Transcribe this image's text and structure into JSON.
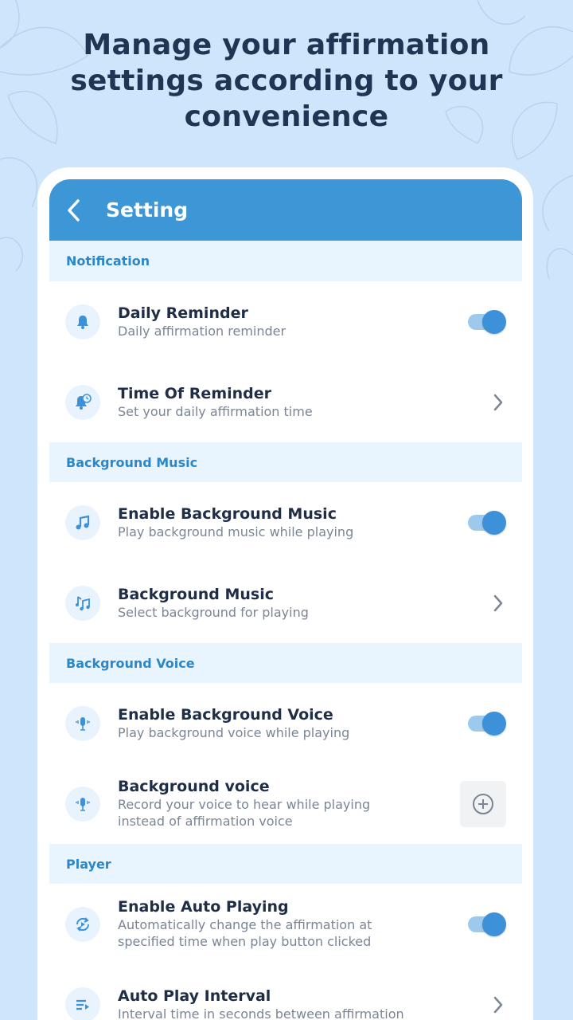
{
  "headline": "Manage your affirmation settings according to your convenience",
  "appbar": {
    "title": "Setting"
  },
  "colors": {
    "accent": "#3d96d6",
    "background": "#cfe5fb",
    "section_bg": "#e9f5fe",
    "section_text": "#2b87c9"
  },
  "sections": [
    {
      "header": "Notification",
      "items": [
        {
          "title": "Daily Reminder",
          "subtitle": "Daily affirmation reminder",
          "icon": "bell-icon",
          "control": "toggle",
          "on": true
        },
        {
          "title": "Time Of Reminder",
          "subtitle": "Set your daily affirmation time",
          "icon": "alarm-clock-icon",
          "control": "chevron"
        }
      ]
    },
    {
      "header": "Background Music",
      "items": [
        {
          "title": "Enable Background Music",
          "subtitle": "Play background music while playing",
          "icon": "music-note-icon",
          "control": "toggle",
          "on": true
        },
        {
          "title": "Background Music",
          "subtitle": "Select background for playing",
          "icon": "music-notes-icon",
          "control": "chevron"
        }
      ]
    },
    {
      "header": "Background Voice",
      "items": [
        {
          "title": "Enable Background Voice",
          "subtitle": "Play background voice while playing",
          "icon": "microphone-icon",
          "control": "toggle",
          "on": true
        },
        {
          "title": "Background voice",
          "subtitle_line1": "Record your voice to hear while playing",
          "subtitle_line2": "instead of affirmation voice",
          "icon": "microphone-icon",
          "control": "add"
        }
      ]
    },
    {
      "header": "Player",
      "items": [
        {
          "title": "Enable Auto Playing",
          "subtitle_line1": "Automatically change the affirmation at",
          "subtitle_line2": "specified  time when play button clicked",
          "icon": "autoplay-icon",
          "control": "toggle",
          "on": true
        },
        {
          "title": "Auto Play Interval",
          "subtitle": "Interval time in seconds between affirmation",
          "icon": "playlist-icon",
          "control": "chevron"
        }
      ]
    }
  ]
}
